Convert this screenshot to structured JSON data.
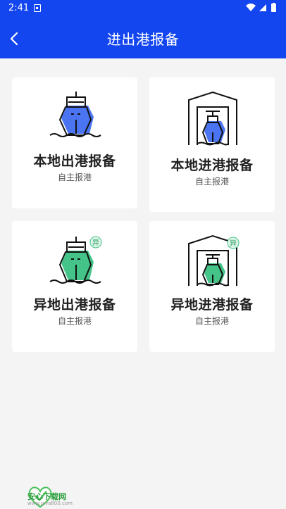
{
  "status_bar": {
    "time": "2:41"
  },
  "header": {
    "title": "进出港报备"
  },
  "cards": [
    {
      "title": "本地出港报备",
      "subtitle": "自主报港",
      "icon": "ship-out-icon"
    },
    {
      "title": "本地进港报备",
      "subtitle": "自主报港",
      "icon": "ship-in-hangar-icon"
    },
    {
      "title": "异地出港报备",
      "subtitle": "自主报港",
      "icon": "ship-out-remote-icon",
      "badge": "异"
    },
    {
      "title": "异地进港报备",
      "subtitle": "自主报港",
      "icon": "ship-in-hangar-remote-icon",
      "badge": "异"
    }
  ],
  "watermark": {
    "name": "安心下载网",
    "url": "www.java800.com"
  },
  "colors": {
    "primary": "#1446f0",
    "blue_accent": "#4a74f2",
    "green_accent": "#44c488"
  }
}
